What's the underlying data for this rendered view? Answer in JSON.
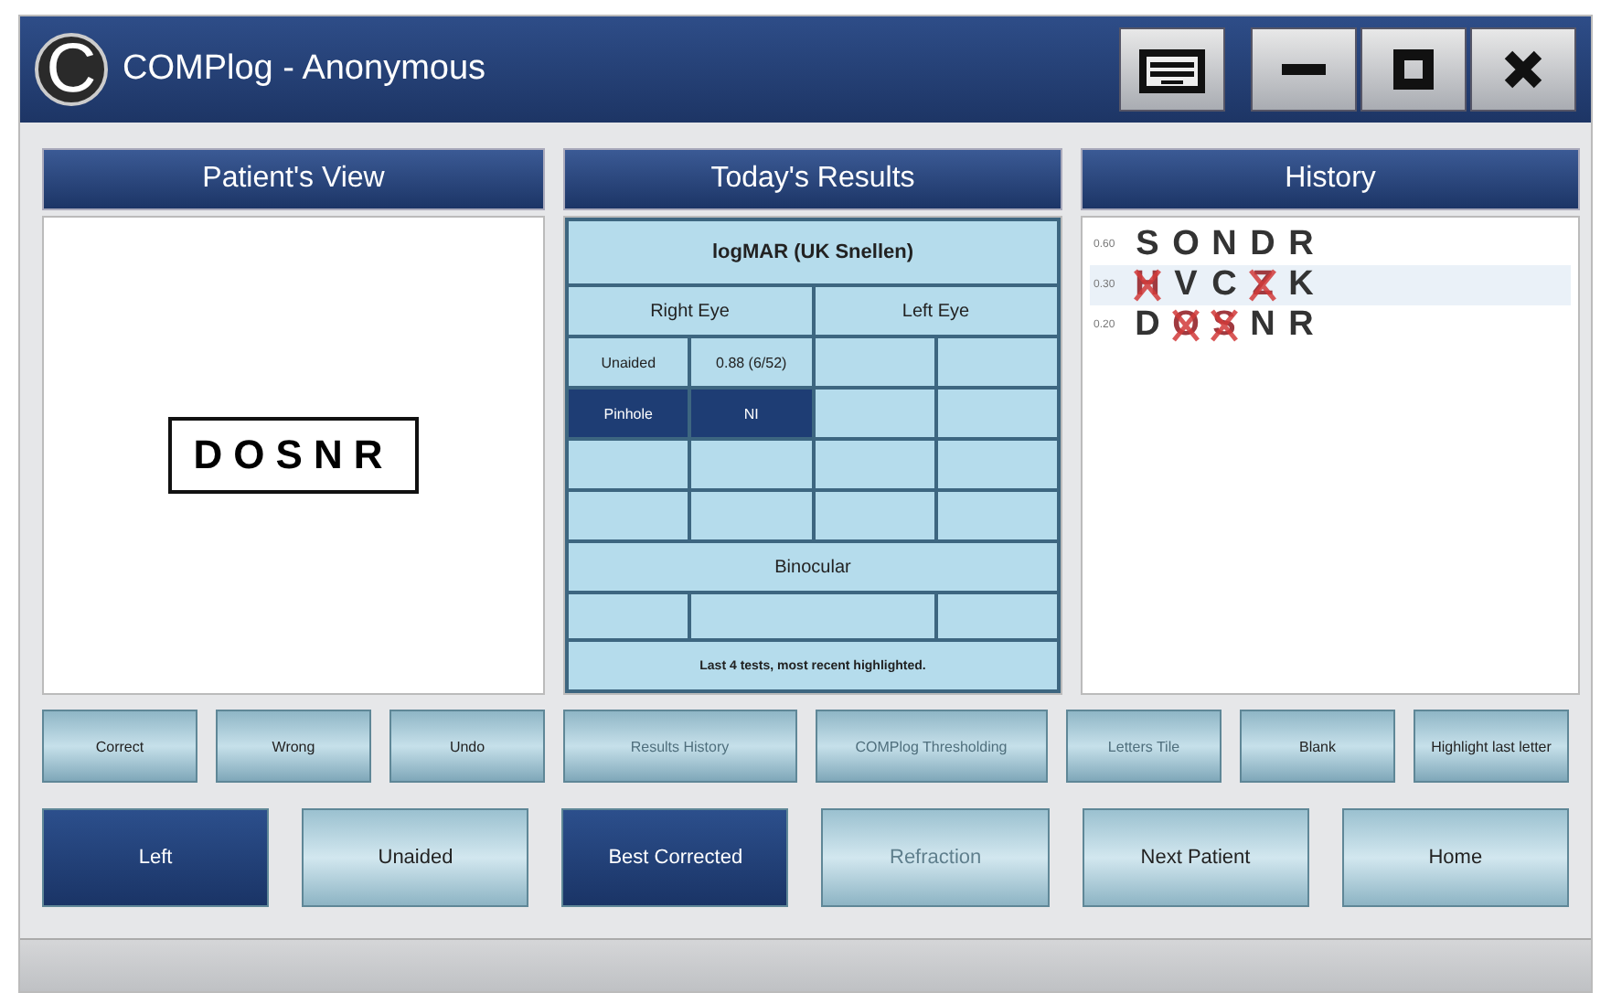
{
  "window": {
    "logo": "C",
    "title": "COMPlog - Anonymous"
  },
  "patient_view": {
    "title": "Patient's View",
    "chart_letters": "DOSNR"
  },
  "todays_results": {
    "title": "Today's Results",
    "scale": "logMAR (UK Snellen)",
    "right_eye": "Right Eye",
    "left_eye": "Left Eye",
    "right_rows": [
      {
        "label": "Unaided",
        "value": "0.88 (6/52)",
        "selected": false
      },
      {
        "label": "Pinhole",
        "value": "NI",
        "selected": true
      }
    ],
    "binocular": "Binocular",
    "footer": "Last 4 tests, most recent highlighted."
  },
  "history": {
    "title": "History",
    "rows": [
      {
        "score": "0.60",
        "selected": false,
        "letters": [
          {
            "char": "S",
            "wrong": false
          },
          {
            "char": "O",
            "wrong": false
          },
          {
            "char": "N",
            "wrong": false
          },
          {
            "char": "D",
            "wrong": false
          },
          {
            "char": "R",
            "wrong": false
          }
        ]
      },
      {
        "score": "0.30",
        "selected": true,
        "letters": [
          {
            "char": "H",
            "wrong": true
          },
          {
            "char": "V",
            "wrong": false
          },
          {
            "char": "C",
            "wrong": false
          },
          {
            "char": "Z",
            "wrong": true
          },
          {
            "char": "K",
            "wrong": false
          }
        ]
      },
      {
        "score": "0.20",
        "selected": false,
        "letters": [
          {
            "char": "D",
            "wrong": false
          },
          {
            "char": "O",
            "wrong": true
          },
          {
            "char": "S",
            "wrong": true
          },
          {
            "char": "N",
            "wrong": false
          },
          {
            "char": "R",
            "wrong": false
          }
        ]
      }
    ]
  },
  "action_buttons": [
    {
      "label": "Correct",
      "disabled": false
    },
    {
      "label": "Wrong",
      "disabled": false
    },
    {
      "label": "Undo",
      "disabled": false
    },
    {
      "label": "Results History",
      "disabled": true
    },
    {
      "label": "COMPlog Thresholding",
      "disabled": true
    },
    {
      "label": "Letters Tile",
      "disabled": true
    },
    {
      "label": "Blank",
      "disabled": false
    },
    {
      "label": "Highlight last letter",
      "disabled": false
    }
  ],
  "mode_buttons": [
    {
      "label": "Left",
      "selected": true,
      "disabled": false
    },
    {
      "label": "Unaided",
      "selected": false,
      "disabled": false
    },
    {
      "label": "Best Corrected",
      "selected": true,
      "disabled": false
    },
    {
      "label": "Refraction",
      "selected": false,
      "disabled": true
    },
    {
      "label": "Next Patient",
      "selected": false,
      "disabled": false
    },
    {
      "label": "Home",
      "selected": false,
      "disabled": false
    }
  ]
}
